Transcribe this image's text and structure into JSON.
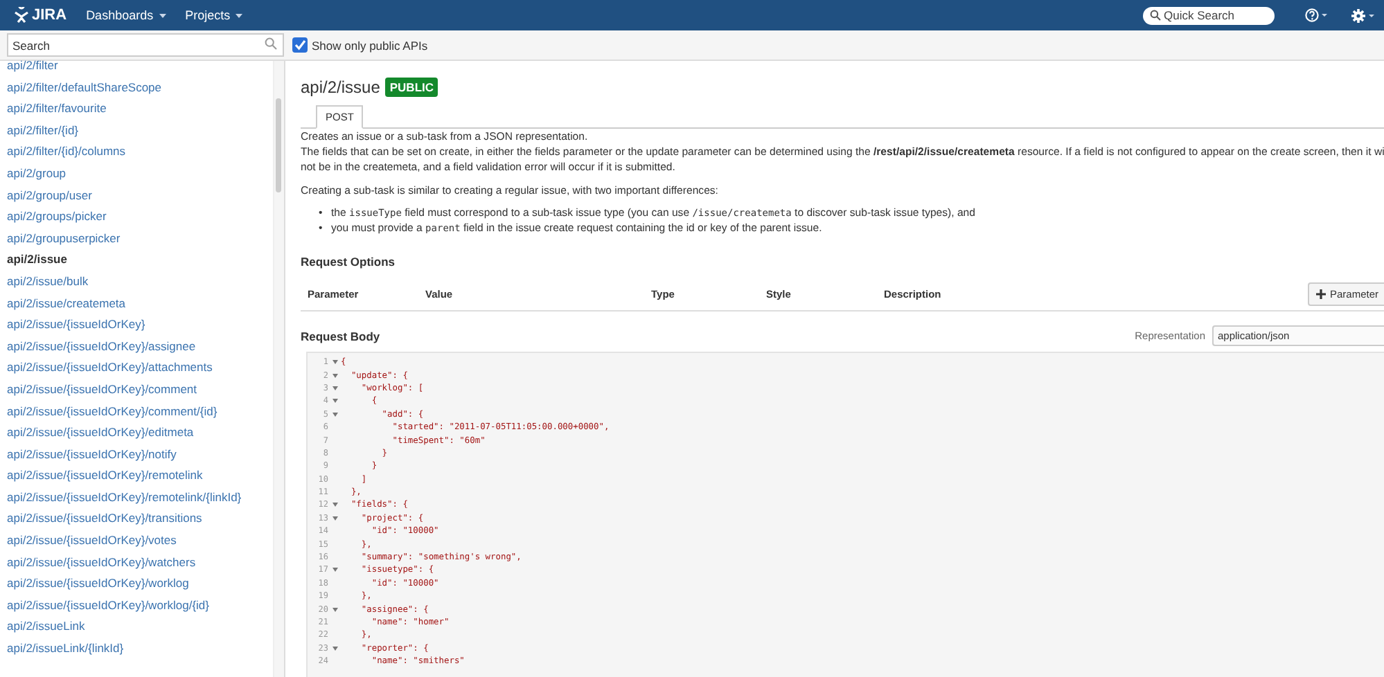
{
  "header": {
    "logo": "JIRA",
    "nav": [
      {
        "label": "Dashboards"
      },
      {
        "label": "Projects"
      }
    ],
    "quick_search": {
      "placeholder": "Quick Search"
    }
  },
  "toolbar": {
    "search": {
      "placeholder": "Search"
    },
    "public_only": {
      "label": "Show only public APIs",
      "checked": true
    }
  },
  "sidebar": {
    "items": [
      {
        "label": "api/2/filter",
        "selected": false
      },
      {
        "label": "api/2/filter/defaultShareScope",
        "selected": false
      },
      {
        "label": "api/2/filter/favourite",
        "selected": false
      },
      {
        "label": "api/2/filter/{id}",
        "selected": false
      },
      {
        "label": "api/2/filter/{id}/columns",
        "selected": false
      },
      {
        "label": "api/2/group",
        "selected": false
      },
      {
        "label": "api/2/group/user",
        "selected": false
      },
      {
        "label": "api/2/groups/picker",
        "selected": false
      },
      {
        "label": "api/2/groupuserpicker",
        "selected": false
      },
      {
        "label": "api/2/issue",
        "selected": true
      },
      {
        "label": "api/2/issue/bulk",
        "selected": false
      },
      {
        "label": "api/2/issue/createmeta",
        "selected": false
      },
      {
        "label": "api/2/issue/{issueIdOrKey}",
        "selected": false
      },
      {
        "label": "api/2/issue/{issueIdOrKey}/assignee",
        "selected": false
      },
      {
        "label": "api/2/issue/{issueIdOrKey}/attachments",
        "selected": false
      },
      {
        "label": "api/2/issue/{issueIdOrKey}/comment",
        "selected": false
      },
      {
        "label": "api/2/issue/{issueIdOrKey}/comment/{id}",
        "selected": false
      },
      {
        "label": "api/2/issue/{issueIdOrKey}/editmeta",
        "selected": false
      },
      {
        "label": "api/2/issue/{issueIdOrKey}/notify",
        "selected": false
      },
      {
        "label": "api/2/issue/{issueIdOrKey}/remotelink",
        "selected": false
      },
      {
        "label": "api/2/issue/{issueIdOrKey}/remotelink/{linkId}",
        "selected": false
      },
      {
        "label": "api/2/issue/{issueIdOrKey}/transitions",
        "selected": false
      },
      {
        "label": "api/2/issue/{issueIdOrKey}/votes",
        "selected": false
      },
      {
        "label": "api/2/issue/{issueIdOrKey}/watchers",
        "selected": false
      },
      {
        "label": "api/2/issue/{issueIdOrKey}/worklog",
        "selected": false
      },
      {
        "label": "api/2/issue/{issueIdOrKey}/worklog/{id}",
        "selected": false
      },
      {
        "label": "api/2/issueLink",
        "selected": false
      },
      {
        "label": "api/2/issueLink/{linkId}",
        "selected": false
      }
    ]
  },
  "main": {
    "title": "api/2/issue",
    "badge": "PUBLIC",
    "tabs": [
      {
        "label": "POST",
        "selected": true
      }
    ],
    "description": [
      "Creates an issue or a sub-task from a JSON representation.",
      "The fields that can be set on create, in either the fields parameter or the update parameter can be determined using the **/rest/api/2/issue/createmeta** resource. If a field is not configured to appear on the create screen, then it wi",
      "not be in the createmeta, and a field validation error will occur if it is submitted."
    ],
    "subtask_intro": "Creating a sub-task is similar to creating a regular issue, with two important differences:",
    "bullets": [
      {
        "marker": "•",
        "parts": [
          {
            "kind": "plain",
            "text": "the "
          },
          {
            "kind": "code",
            "text": "issueType"
          },
          {
            "kind": "plain",
            "text": " field must correspond to a sub-task issue type (you can use "
          },
          {
            "kind": "code",
            "text": "/issue/createmeta"
          },
          {
            "kind": "plain",
            "text": " to discover sub-task issue types), and"
          }
        ]
      },
      {
        "marker": "•",
        "parts": [
          {
            "kind": "plain",
            "text": "you must provide a "
          },
          {
            "kind": "code",
            "text": "parent"
          },
          {
            "kind": "plain",
            "text": " field in the issue create request containing the id or key of the parent issue."
          }
        ]
      }
    ],
    "request_options": {
      "heading": "Request Options",
      "columns": [
        "Parameter",
        "Value",
        "Type",
        "Style",
        "Description"
      ],
      "add_button": "Parameter"
    },
    "request_body": {
      "heading": "Request Body",
      "representation_label": "Representation",
      "representation": "application/json",
      "lines": [
        {
          "n": "1",
          "fold": true,
          "text": "{"
        },
        {
          "n": "2",
          "fold": true,
          "text": "  \"update\": {"
        },
        {
          "n": "3",
          "fold": true,
          "text": "    \"worklog\": ["
        },
        {
          "n": "4",
          "fold": true,
          "text": "      {"
        },
        {
          "n": "5",
          "fold": true,
          "text": "        \"add\": {"
        },
        {
          "n": "6",
          "fold": false,
          "text": "          \"started\": \"2011-07-05T11:05:00.000+0000\","
        },
        {
          "n": "7",
          "fold": false,
          "text": "          \"timeSpent\": \"60m\""
        },
        {
          "n": "8",
          "fold": false,
          "text": "        }"
        },
        {
          "n": "9",
          "fold": false,
          "text": "      }"
        },
        {
          "n": "10",
          "fold": false,
          "text": "    ]"
        },
        {
          "n": "11",
          "fold": false,
          "text": "  },"
        },
        {
          "n": "12",
          "fold": true,
          "text": "  \"fields\": {"
        },
        {
          "n": "13",
          "fold": true,
          "text": "    \"project\": {"
        },
        {
          "n": "14",
          "fold": false,
          "text": "      \"id\": \"10000\""
        },
        {
          "n": "15",
          "fold": false,
          "text": "    },"
        },
        {
          "n": "16",
          "fold": false,
          "text": "    \"summary\": \"something's wrong\","
        },
        {
          "n": "17",
          "fold": true,
          "text": "    \"issuetype\": {"
        },
        {
          "n": "18",
          "fold": false,
          "text": "      \"id\": \"10000\""
        },
        {
          "n": "19",
          "fold": false,
          "text": "    },"
        },
        {
          "n": "20",
          "fold": true,
          "text": "    \"assignee\": {"
        },
        {
          "n": "21",
          "fold": false,
          "text": "      \"name\": \"homer\""
        },
        {
          "n": "22",
          "fold": false,
          "text": "    },"
        },
        {
          "n": "23",
          "fold": true,
          "text": "    \"reporter\": {"
        },
        {
          "n": "24",
          "fold": false,
          "text": "      \"name\": \"smithers\""
        }
      ]
    }
  }
}
